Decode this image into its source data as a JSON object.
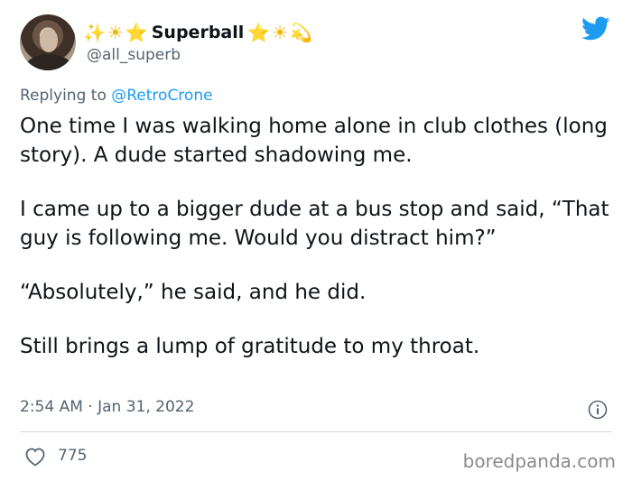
{
  "author": {
    "display_name": "Superball",
    "handle": "@all_superb",
    "emoji_left": [
      "✨",
      "☀",
      "⭐"
    ],
    "emoji_right": [
      "⭐",
      "☀",
      "💫"
    ]
  },
  "reply": {
    "prefix": "Replying to ",
    "mention": "@RetroCrone"
  },
  "tweet": {
    "paragraphs": [
      "One time I was walking home alone in club clothes (long story). A dude started shadowing me.",
      "I came up to a bigger dude at a bus stop and said, “That guy is following me. Would you distract him?”",
      "“Absolutely,” he said, and he did.",
      "Still brings a lump of gratitude to my throat."
    ],
    "timestamp": "2:54 AM · Jan 31, 2022"
  },
  "stats": {
    "likes": "775"
  },
  "watermark": "boredpanda.com",
  "colors": {
    "twitter_blue": "#1d9bf0",
    "secondary_text": "#536471"
  },
  "icons": [
    "twitter-bird-icon",
    "info-icon",
    "heart-icon"
  ]
}
